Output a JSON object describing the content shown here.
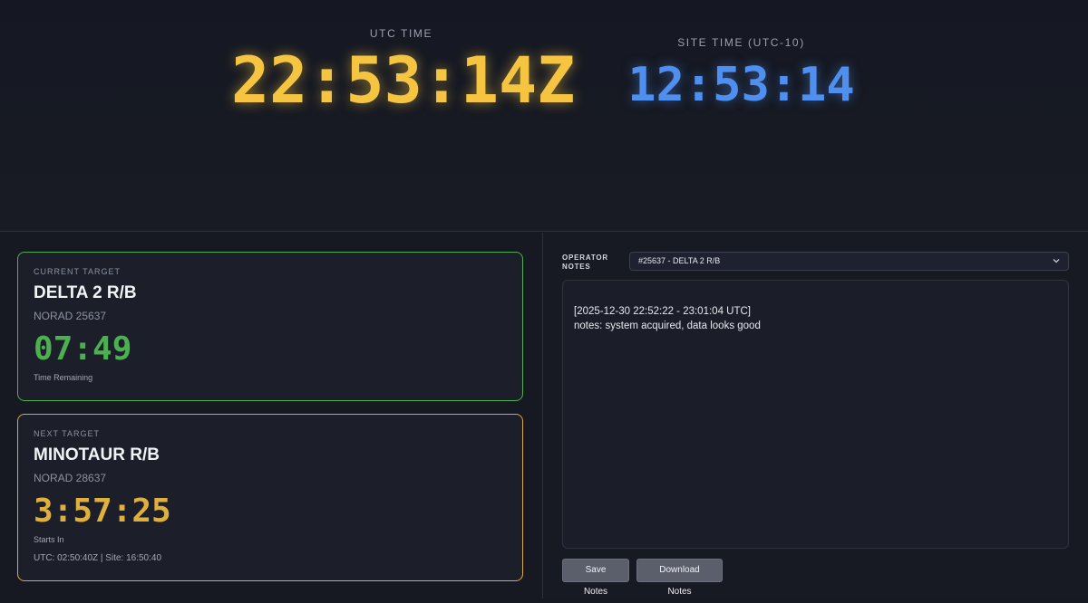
{
  "clocks": {
    "utc_label": "UTC TIME",
    "utc_value": "22:53:14Z",
    "site_label": "SITE TIME (UTC-10)",
    "site_value": "12:53:14"
  },
  "current_target": {
    "kicker": "CURRENT TARGET",
    "name": "DELTA 2 R/B",
    "norad": "NORAD 25637",
    "countdown": "07:49",
    "caption": "Time Remaining"
  },
  "next_target": {
    "kicker": "NEXT TARGET",
    "name": "MINOTAUR R/B",
    "norad": "NORAD 28637",
    "countdown": "3:57:25",
    "caption": "Starts In",
    "times": "UTC: 02:50:40Z | Site: 16:50:40"
  },
  "notes": {
    "label_line1": "OPERATOR",
    "label_line2": "NOTES",
    "selected_pass": "#25637 - DELTA 2 R/B",
    "line1": "[2025-12-30 22:52:22 - 23:01:04 UTC]",
    "line2": "notes: system acquired, data looks good",
    "save_label": "Save Notes",
    "download_label": "Download Notes"
  },
  "colors": {
    "utc_clock": "#f5c542",
    "site_clock": "#4f8ff0",
    "current_border": "#4caf50",
    "next_border": "#d9a93e"
  },
  "icons": {
    "select_chevron": "chevron-down-icon"
  }
}
